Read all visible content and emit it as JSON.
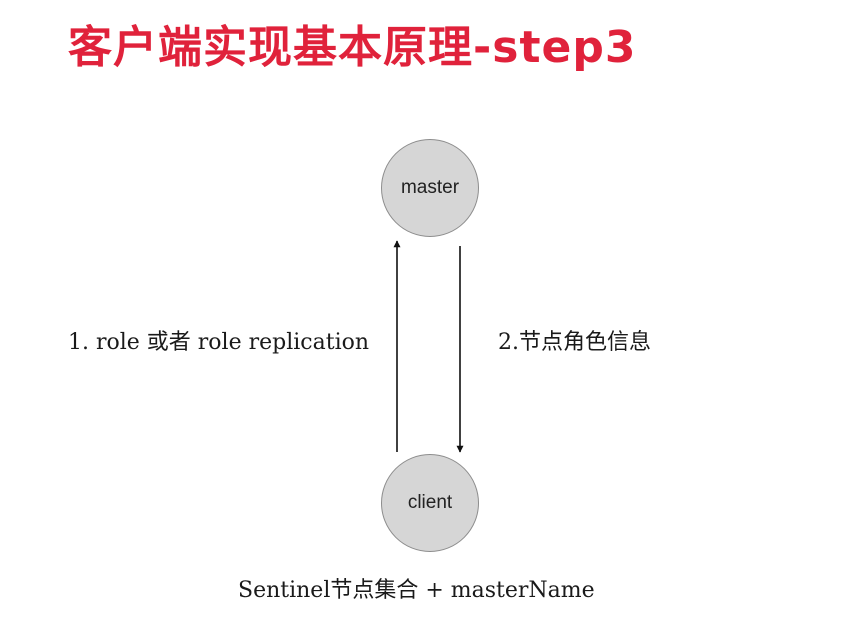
{
  "title": "客户端实现基本原理-step3",
  "colors": {
    "title": "#e0223b",
    "node_fill": "#d6d6d6",
    "node_border": "#8d8d8d",
    "arrow": "#111111"
  },
  "nodes": {
    "master": "master",
    "client": "client"
  },
  "edges": {
    "request_label": "1. role 或者 role replication",
    "response_label": "2.节点角色信息"
  },
  "caption": "Sentinel节点集合 + masterName"
}
